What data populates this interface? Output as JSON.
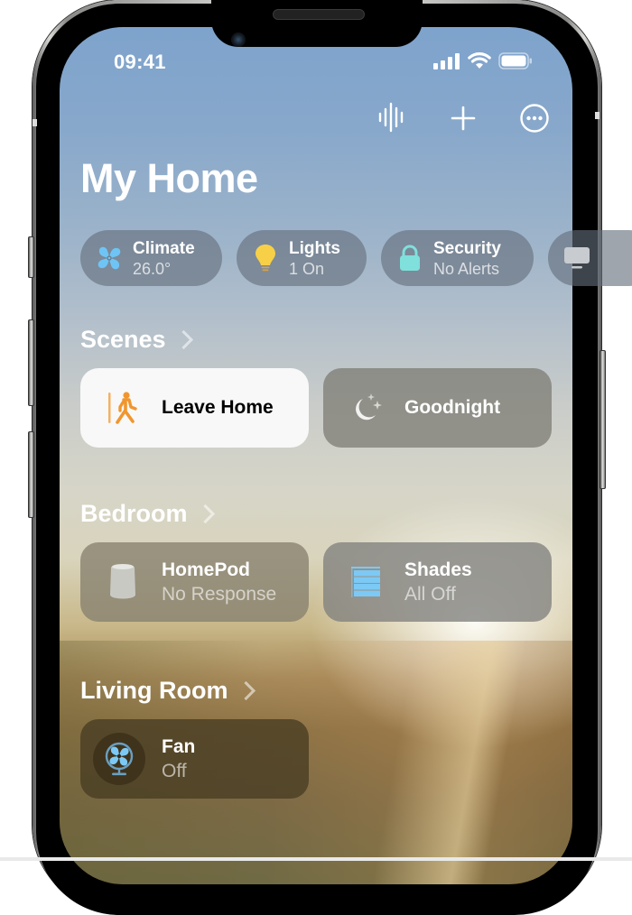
{
  "status_bar": {
    "time": "09:41"
  },
  "toolbar": {
    "voice_icon": "waveform-icon",
    "add_icon": "plus-icon",
    "more_icon": "ellipsis-circle-icon"
  },
  "header": {
    "title": "My Home"
  },
  "chips": [
    {
      "title": "Climate",
      "subtitle": "26.0°",
      "icon": "fan-icon",
      "icon_color": "#6ec4f5"
    },
    {
      "title": "Lights",
      "subtitle": "1 On",
      "icon": "lightbulb-icon",
      "icon_color": "#f7d047"
    },
    {
      "title": "Security",
      "subtitle": "No Alerts",
      "icon": "lock-icon",
      "icon_color": "#7fe0dc"
    },
    {
      "title": "",
      "subtitle": "",
      "icon": "tv-icon",
      "icon_color": "#c8cbd0"
    }
  ],
  "sections": [
    {
      "title": "Scenes",
      "tiles": [
        {
          "title": "Leave Home",
          "subtitle": "",
          "icon": "walking-person-icon",
          "icon_color": "#f0962e",
          "active": true
        },
        {
          "title": "Goodnight",
          "subtitle": "",
          "icon": "moon-stars-icon",
          "icon_color": "#f2f2f0",
          "active": false
        }
      ]
    },
    {
      "title": "Bedroom",
      "tiles": [
        {
          "title": "HomePod",
          "subtitle": "No Response",
          "icon": "homepod-icon",
          "icon_color": "#c9c9c4"
        },
        {
          "title": "Shades",
          "subtitle": "All Off",
          "icon": "shades-icon",
          "icon_color": "#7cc9f5"
        }
      ]
    },
    {
      "title": "Living Room",
      "tiles": [
        {
          "title": "Fan",
          "subtitle": "Off",
          "icon": "fan-icon",
          "icon_color": "#7cc9f5"
        }
      ]
    }
  ]
}
